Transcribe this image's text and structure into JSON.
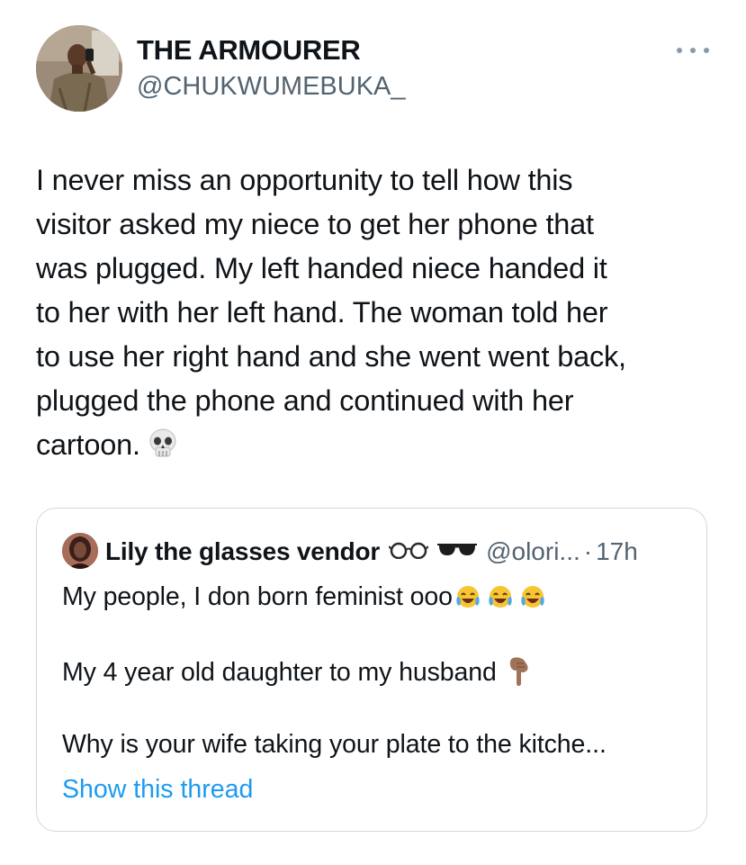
{
  "tweet": {
    "display_name": "THE ARMOURER",
    "handle": "@CHUKWUMEBUKA_",
    "more_icon": "more-horizontal-icon",
    "text": "I never miss an opportunity to tell how this\nvisitor asked my niece to get her phone that\nwas plugged. My left handed niece handed it\nto her with her left hand. The woman told her\nto use her right hand and she went went back,\nplugged the phone and continued with her\ncartoon.",
    "text_emoji": "skull-emoji"
  },
  "quote": {
    "display_name": "Lily the glasses vendor",
    "name_emojis": [
      "glasses-emoji",
      "sunglasses-emoji"
    ],
    "handle": "@olori...",
    "separator": "·",
    "time": "17h",
    "line1": "My people, I don born feminist ooo",
    "line1_emojis": [
      "tears-of-joy-emoji",
      "tears-of-joy-emoji",
      "tears-of-joy-emoji"
    ],
    "line2": "My 4 year old daughter to my husband",
    "line2_emoji": "pointing-down-emoji",
    "line3": "Why is your wife taking your plate to the kitche...",
    "show_thread": "Show this thread"
  },
  "colors": {
    "text_primary": "#0f1419",
    "text_secondary": "#536471",
    "link": "#1d9bf0",
    "border": "#cfd9de"
  }
}
